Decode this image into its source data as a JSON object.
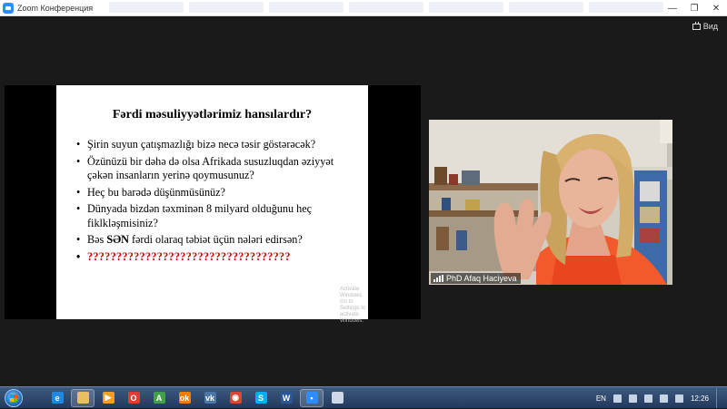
{
  "window": {
    "title": "Zoom Конференция",
    "minimize": "—",
    "restore": "❐",
    "close": "✕"
  },
  "view_button": {
    "label": "Вид"
  },
  "slide": {
    "title": "Fərdi məsuliyyətlərimiz hansılardır?",
    "bullets": [
      "Şirin suyun çatışmazlığı bizə necə təsir göstərəcək?",
      "Özünüzü bir dəhə də olsa Afrikada susuzluqdan əziyyət çəkən insanların yerinə qoymusunuz?",
      "Heç bu barədə düşünmüsünüz?",
      "Dünyada bizdən təxminən 8 milyard olduğunu heç fiklkləşmisiniz?"
    ],
    "bullet5": {
      "pre": "Bəs ",
      "bold": "SƏN",
      "post": " fərdi olaraq təbiət üçün nələri edirsən?"
    },
    "bullet6": "???????????????????????????????????",
    "watermark_line1": "Activate Windows",
    "watermark_line2": "Go to Settings to activate Windows."
  },
  "video": {
    "participant_name": "PhD Afaq Haciyeva"
  },
  "taskbar": {
    "apps": [
      {
        "name": "internet-explorer-icon",
        "glyph": "e",
        "color": "#1e88e5"
      },
      {
        "name": "file-explorer-icon",
        "glyph": "",
        "color": "#e8c060"
      },
      {
        "name": "media-player-icon",
        "glyph": "▶",
        "color": "#f0a020"
      },
      {
        "name": "opera-icon",
        "glyph": "O",
        "color": "#e53935"
      },
      {
        "name": "android-icon",
        "glyph": "A",
        "color": "#43a047"
      },
      {
        "name": "odnoklassniki-icon",
        "glyph": "ok",
        "color": "#f57c00"
      },
      {
        "name": "vk-icon",
        "glyph": "vk",
        "color": "#4a76a8"
      },
      {
        "name": "chrome-icon",
        "glyph": "◉",
        "color": "#db4437"
      },
      {
        "name": "skype-icon",
        "glyph": "S",
        "color": "#00aff0"
      },
      {
        "name": "word-icon",
        "glyph": "W",
        "color": "#2b579a"
      },
      {
        "name": "zoom-icon",
        "glyph": "▪",
        "color": "#2d8cff"
      },
      {
        "name": "window-thumb-icon",
        "glyph": "",
        "color": "#cfd8e6"
      }
    ],
    "language": "EN",
    "time": "12:26"
  }
}
